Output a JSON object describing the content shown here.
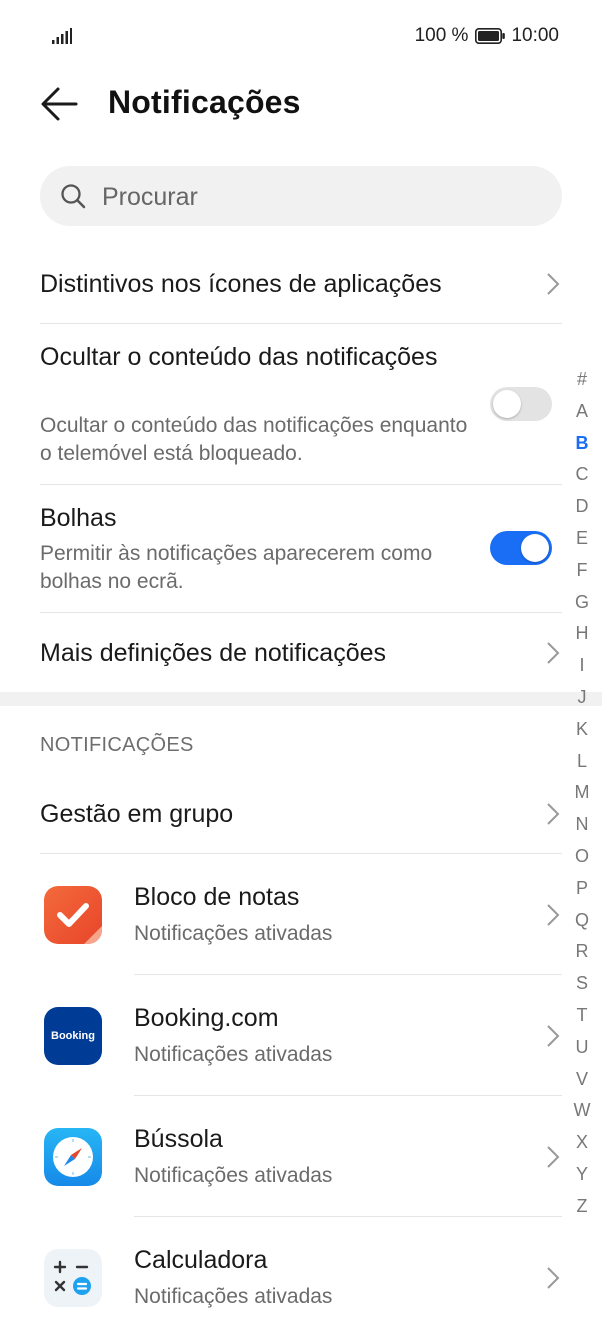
{
  "status": {
    "battery": "100 %",
    "time": "10:00"
  },
  "header": {
    "title": "Notificações"
  },
  "search": {
    "placeholder": "Procurar"
  },
  "settings": {
    "badges": "Distintivos nos ícones de aplicações",
    "hide_title": "Ocultar o conteúdo das notificações",
    "hide_sub": "Ocultar o conteúdo das notificações enquanto o telemóvel está bloqueado.",
    "hide_enabled": false,
    "bubbles_title": "Bolhas",
    "bubbles_sub": "Permitir às notificações aparecerem como bolhas no ecrã.",
    "bubbles_enabled": true,
    "more": "Mais definições de notificações"
  },
  "section": {
    "header": "NOTIFICAÇÕES",
    "group": "Gestão em grupo"
  },
  "apps": [
    {
      "name": "Bloco de notas",
      "status": "Notificações ativadas",
      "icon": "notepad-icon"
    },
    {
      "name": "Booking.com",
      "status": "Notificações ativadas",
      "icon": "booking-icon",
      "icon_text": "Booking"
    },
    {
      "name": "Bússola",
      "status": "Notificações ativadas",
      "icon": "compass-icon"
    },
    {
      "name": "Calculadora",
      "status": "Notificações ativadas",
      "icon": "calculator-icon"
    }
  ],
  "alpha_index": [
    "#",
    "A",
    "B",
    "C",
    "D",
    "E",
    "F",
    "G",
    "H",
    "I",
    "J",
    "K",
    "L",
    "M",
    "N",
    "O",
    "P",
    "Q",
    "R",
    "S",
    "T",
    "U",
    "V",
    "W",
    "X",
    "Y",
    "Z"
  ],
  "alpha_active": "B",
  "colors": {
    "accent": "#1a6ef5",
    "toggle_off": "#e3e3e3",
    "booking": "#003b95"
  }
}
